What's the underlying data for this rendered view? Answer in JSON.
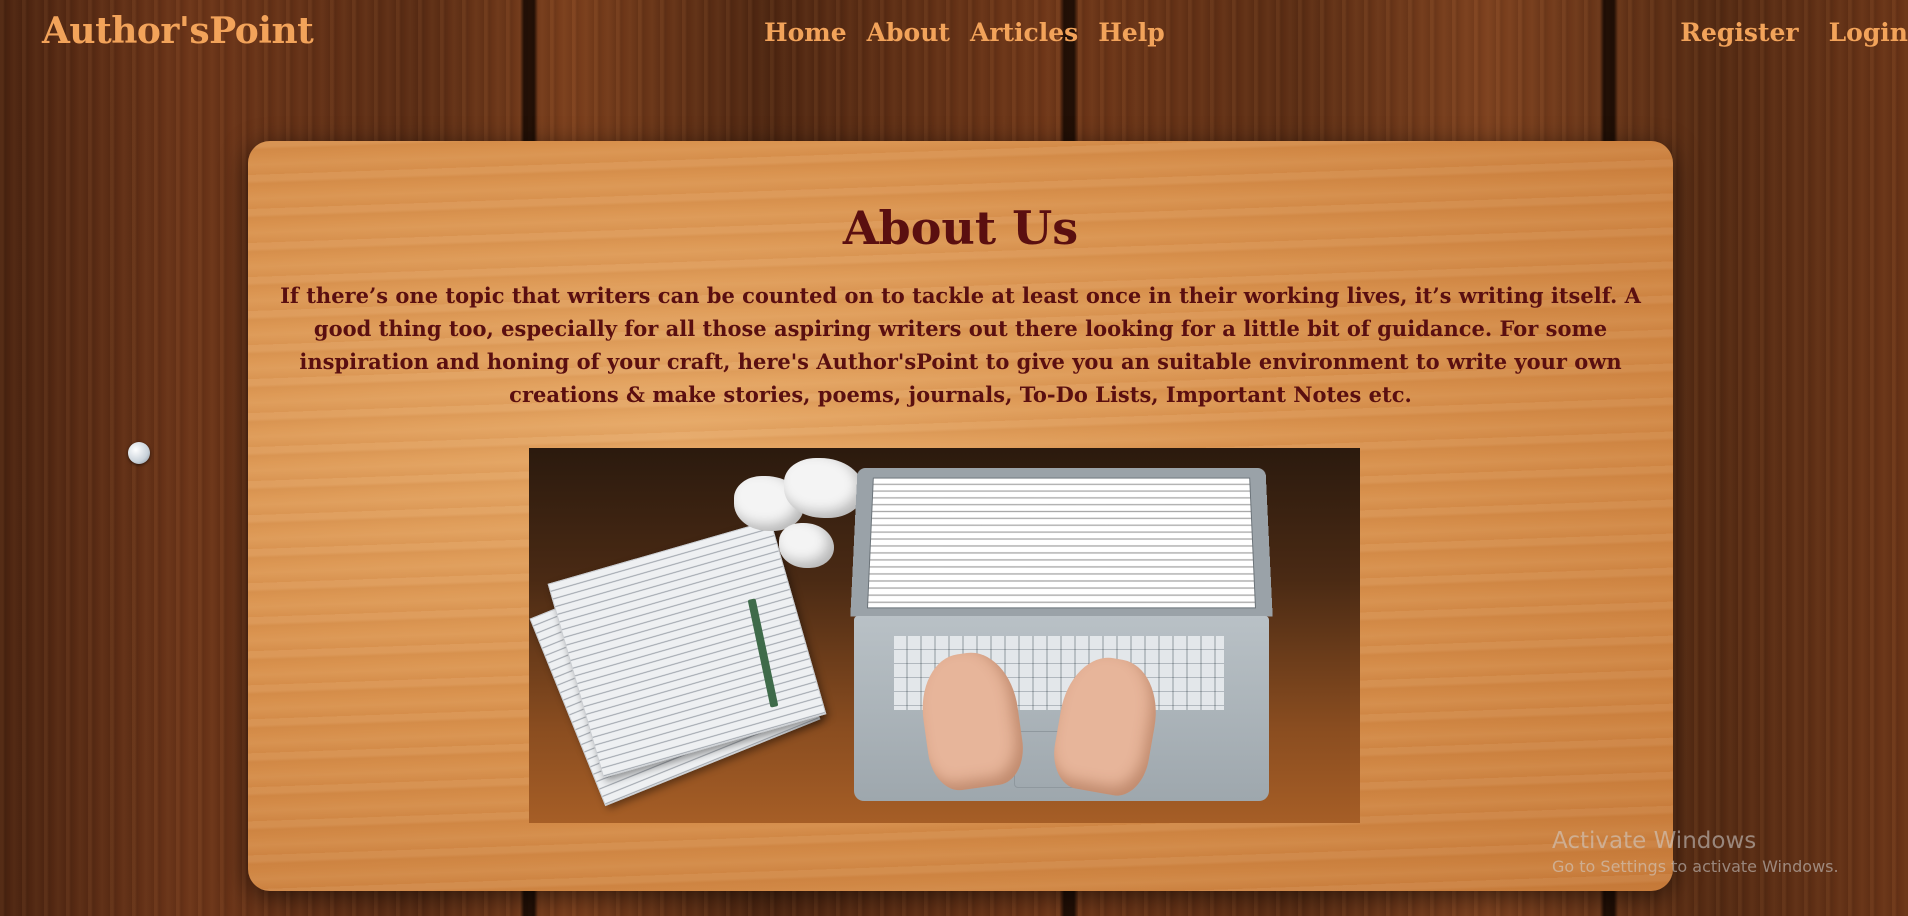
{
  "brand": "Author'sPoint",
  "nav": {
    "items": [
      "Home",
      "About",
      "Articles",
      "Help"
    ]
  },
  "auth": {
    "register": "Register",
    "login": "Login"
  },
  "about": {
    "title": "About Us",
    "text": "If there’s one topic that writers can be counted on to tackle at least once in their working lives, it’s writing itself. A good thing too, especially for all those aspiring writers out there looking for a little bit of guidance. For some inspiration and honing of your craft, here's Author'sPoint to give you an suitable environment to write your own creations & make stories, poems, journals, To-Do Lists, Important Notes etc."
  },
  "watermark": {
    "title": "Activate Windows",
    "subtitle": "Go to Settings to activate Windows."
  },
  "colors": {
    "accent": "#f2a35a",
    "heading": "#5a0f10"
  }
}
